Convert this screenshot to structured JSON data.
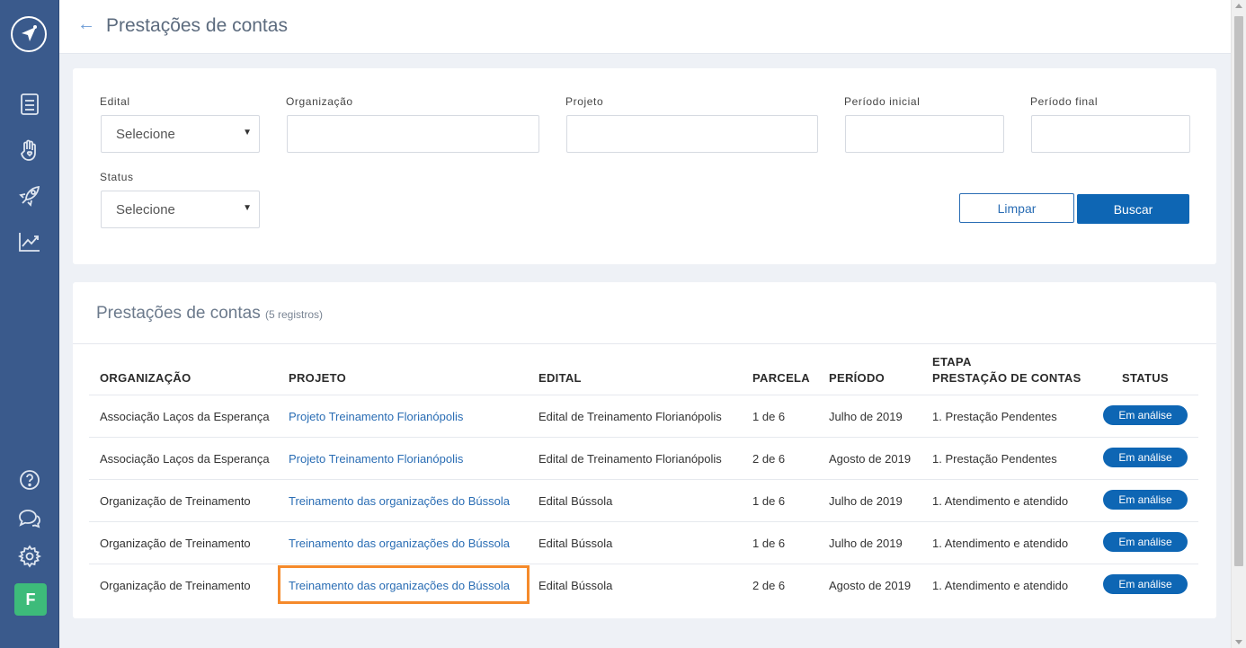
{
  "header": {
    "back_icon": "arrow-left-icon",
    "title": "Prestações de contas"
  },
  "sidebar": {
    "logo_icon": "compass-logo-icon",
    "top_icons": [
      "document-icon",
      "hand-heart-icon",
      "rocket-icon",
      "chart-line-icon"
    ],
    "bottom_icons": [
      "help-icon",
      "chat-icon",
      "gear-icon"
    ],
    "avatar": "F",
    "avatar_color": "#3dbb7a",
    "bg_color": "#3a5a8c"
  },
  "filters": {
    "edital": {
      "label": "Edital",
      "value": "Selecione"
    },
    "organizacao": {
      "label": "Organização",
      "value": ""
    },
    "projeto": {
      "label": "Projeto",
      "value": ""
    },
    "periodo_inicial": {
      "label": "Período inicial",
      "value": ""
    },
    "periodo_final": {
      "label": "Período final",
      "value": ""
    },
    "status": {
      "label": "Status",
      "value": "Selecione"
    },
    "clear_label": "Limpar",
    "search_label": "Buscar"
  },
  "table": {
    "title": "Prestações de contas",
    "count": "(5 registros)",
    "headers": {
      "organizacao": "ORGANIZAÇÃO",
      "projeto": "PROJETO",
      "edital": "EDITAL",
      "parcela": "PARCELA",
      "periodo": "PERÍODO",
      "etapa_line1": "ETAPA",
      "etapa_line2": "PRESTAÇÃO DE CONTAS",
      "status": "STATUS"
    },
    "rows": [
      {
        "organizacao": "Associação Laços da Esperança",
        "projeto": "Projeto Treinamento Florianópolis",
        "edital": "Edital de Treinamento Florianópolis",
        "parcela": "1 de 6",
        "periodo": "Julho de 2019",
        "etapa": "1. Prestação Pendentes",
        "status": "Em análise"
      },
      {
        "organizacao": "Associação Laços da Esperança",
        "projeto": "Projeto Treinamento Florianópolis",
        "edital": "Edital de Treinamento Florianópolis",
        "parcela": "2 de 6",
        "periodo": "Agosto de 2019",
        "etapa": "1. Prestação Pendentes",
        "status": "Em análise"
      },
      {
        "organizacao": "Organização de Treinamento",
        "projeto": "Treinamento das organizações do Bússola",
        "edital": "Edital Bússola",
        "parcela": "1 de 6",
        "periodo": "Julho de 2019",
        "etapa": "1. Atendimento e atendido",
        "status": "Em análise"
      },
      {
        "organizacao": "Organização de Treinamento",
        "projeto": "Treinamento das organizações do Bússola",
        "edital": "Edital Bússola",
        "parcela": "1 de 6",
        "periodo": "Julho de 2019",
        "etapa": "1. Atendimento e atendido",
        "status": "Em análise"
      },
      {
        "organizacao": "Organização de Treinamento",
        "projeto": "Treinamento das organizações do Bússola",
        "edital": "Edital Bússola",
        "parcela": "2 de 6",
        "periodo": "Agosto de 2019",
        "etapa": "1. Atendimento e atendido",
        "status": "Em análise"
      }
    ],
    "status_badge_color": "#0e66b4",
    "highlight_color": "#f58a2b"
  }
}
